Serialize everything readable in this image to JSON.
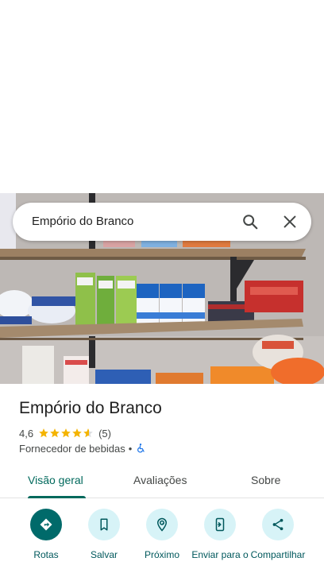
{
  "search": {
    "query": "Empório do Branco"
  },
  "place": {
    "name": "Empório do Branco",
    "rating": "4,6",
    "stars": 4.6,
    "review_count": "(5)",
    "category": "Fornecedor de bebidas",
    "separator": "•"
  },
  "tabs": [
    {
      "label": "Visão geral",
      "active": true
    },
    {
      "label": "Avaliações",
      "active": false
    },
    {
      "label": "Sobre",
      "active": false
    }
  ],
  "actions": [
    {
      "label": "Rotas",
      "icon": "directions-icon"
    },
    {
      "label": "Salvar",
      "icon": "bookmark-icon"
    },
    {
      "label": "Próximo",
      "icon": "nearby-icon"
    },
    {
      "label": "Enviar para o",
      "icon": "send-to-phone-icon"
    },
    {
      "label": "Compartilhar",
      "icon": "share-icon"
    }
  ],
  "colors": {
    "accent": "#00695c",
    "primary_button": "#006a6a",
    "action_circle": "#d7f3f7",
    "star": "#f4b400"
  }
}
